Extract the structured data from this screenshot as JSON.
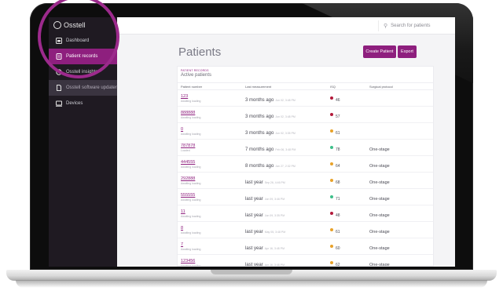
{
  "app": {
    "logo_text": "Osstell"
  },
  "sidebar": {
    "items": [
      {
        "label": "Dashboard",
        "icon": "dashboard-icon"
      },
      {
        "label": "Patient records",
        "icon": "patient-records-icon",
        "active": true
      },
      {
        "label": "Osstell insights",
        "icon": "insights-icon"
      },
      {
        "label": "Osstell software updater",
        "icon": "document-icon",
        "muted": true
      },
      {
        "label": "Devices",
        "icon": "devices-icon"
      }
    ]
  },
  "search": {
    "placeholder": "Search for patients"
  },
  "page": {
    "title": "Patients"
  },
  "buttons": {
    "create": "Create Patient",
    "export": "Export"
  },
  "card": {
    "eyebrow": "PATIENT RECORDS",
    "subtitle": "Active patients"
  },
  "table": {
    "headers": [
      "Patient number",
      "Last measurement",
      "ISQ",
      "Surgical protocol"
    ],
    "rows": [
      {
        "id": "123",
        "status": "Awaiting loading",
        "when": "3 months ago",
        "date": "Jun 02, 3:48 PM",
        "isq": "46",
        "isq_color": "#b3193a",
        "protocol": ""
      },
      {
        "id": "888888",
        "status": "Awaiting loading",
        "when": "3 months ago",
        "date": "Jun 02, 3:48 PM",
        "isq": "57",
        "isq_color": "#b3193a",
        "protocol": ""
      },
      {
        "id": "0",
        "status": "Awaiting loading",
        "when": "3 months ago",
        "date": "Jun 02, 3:35 PM",
        "isq": "61",
        "isq_color": "#e8a22a",
        "protocol": ""
      },
      {
        "id": "787878",
        "status": "Loaded",
        "when": "7 months ago",
        "date": "Feb 06, 3:48 PM",
        "isq": "78",
        "isq_color": "#3ebf8a",
        "protocol": "One-stage"
      },
      {
        "id": "444555",
        "status": "Awaiting loading",
        "when": "8 months ago",
        "date": "Jan 27, 2:32 PM",
        "isq": "64",
        "isq_color": "#e8a22a",
        "protocol": "One-stage"
      },
      {
        "id": "292888",
        "status": "Awaiting loading",
        "when": "last year",
        "date": "Sep 26, 4:46 PM",
        "isq": "68",
        "isq_color": "#e8a22a",
        "protocol": "One-stage"
      },
      {
        "id": "555555",
        "status": "Awaiting loading",
        "when": "last year",
        "date": "Jun 09, 3:46 PM",
        "isq": "71",
        "isq_color": "#3ebf8a",
        "protocol": "One-stage"
      },
      {
        "id": "11",
        "status": "Awaiting loading",
        "when": "last year",
        "date": "Jun 09, 3:35 PM",
        "isq": "48",
        "isq_color": "#b3193a",
        "protocol": "One-stage"
      },
      {
        "id": "8",
        "status": "Awaiting loading",
        "when": "last year",
        "date": "May 05, 3:48 PM",
        "isq": "61",
        "isq_color": "#e8a22a",
        "protocol": "One-stage"
      },
      {
        "id": "7",
        "status": "Awaiting loading",
        "when": "last year",
        "date": "Apr 16, 3:48 PM",
        "isq": "60",
        "isq_color": "#e8a22a",
        "protocol": "One-stage"
      },
      {
        "id": "123456",
        "status": "Awaiting loading",
        "when": "last year",
        "date": "Apr 16, 3:48 PM",
        "isq": "62",
        "isq_color": "#e8a22a",
        "protocol": "One-stage"
      }
    ]
  },
  "colors": {
    "brand": "#8e1f7e",
    "sidebar_bg": "#1f1a22",
    "highlight": "#9c2a8c"
  }
}
